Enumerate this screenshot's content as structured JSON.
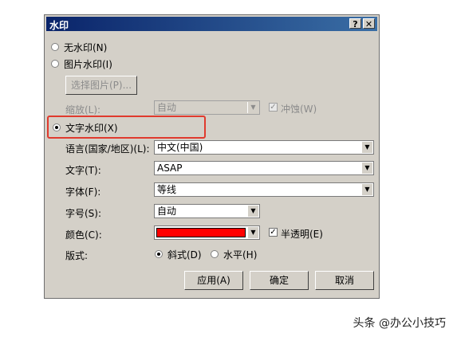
{
  "window": {
    "title": "水印",
    "help_glyph": "?",
    "close_glyph": "✕"
  },
  "options": {
    "none": "无水印(N)",
    "picture": "图片水印(I)",
    "select_picture": "选择图片(P)...",
    "scale_label": "缩放(L):",
    "scale_value": "自动",
    "washout": "冲蚀(W)",
    "text": "文字水印(X)"
  },
  "text_settings": {
    "language_label": "语言(国家/地区)(L):",
    "language_value": "中文(中国)",
    "text_label": "文字(T):",
    "text_value": "ASAP",
    "font_label": "字体(F):",
    "font_value": "等线",
    "size_label": "字号(S):",
    "size_value": "自动",
    "color_label": "颜色(C):",
    "color_value": "#ff0000",
    "semitransparent": "半透明(E)",
    "layout_label": "版式:",
    "layout_diagonal": "斜式(D)",
    "layout_horizontal": "水平(H)"
  },
  "buttons": {
    "apply": "应用(A)",
    "ok": "确定",
    "cancel": "取消"
  },
  "watermark_credit": "头条 @办公小技巧",
  "state": {
    "selected": "text",
    "semitransparent_checked": true,
    "washout_checked": true,
    "layout": "diagonal"
  },
  "colors": {
    "title_bar": "#0a246a",
    "dialog_bg": "#d4d0c8",
    "highlight": "#e03a2e"
  }
}
